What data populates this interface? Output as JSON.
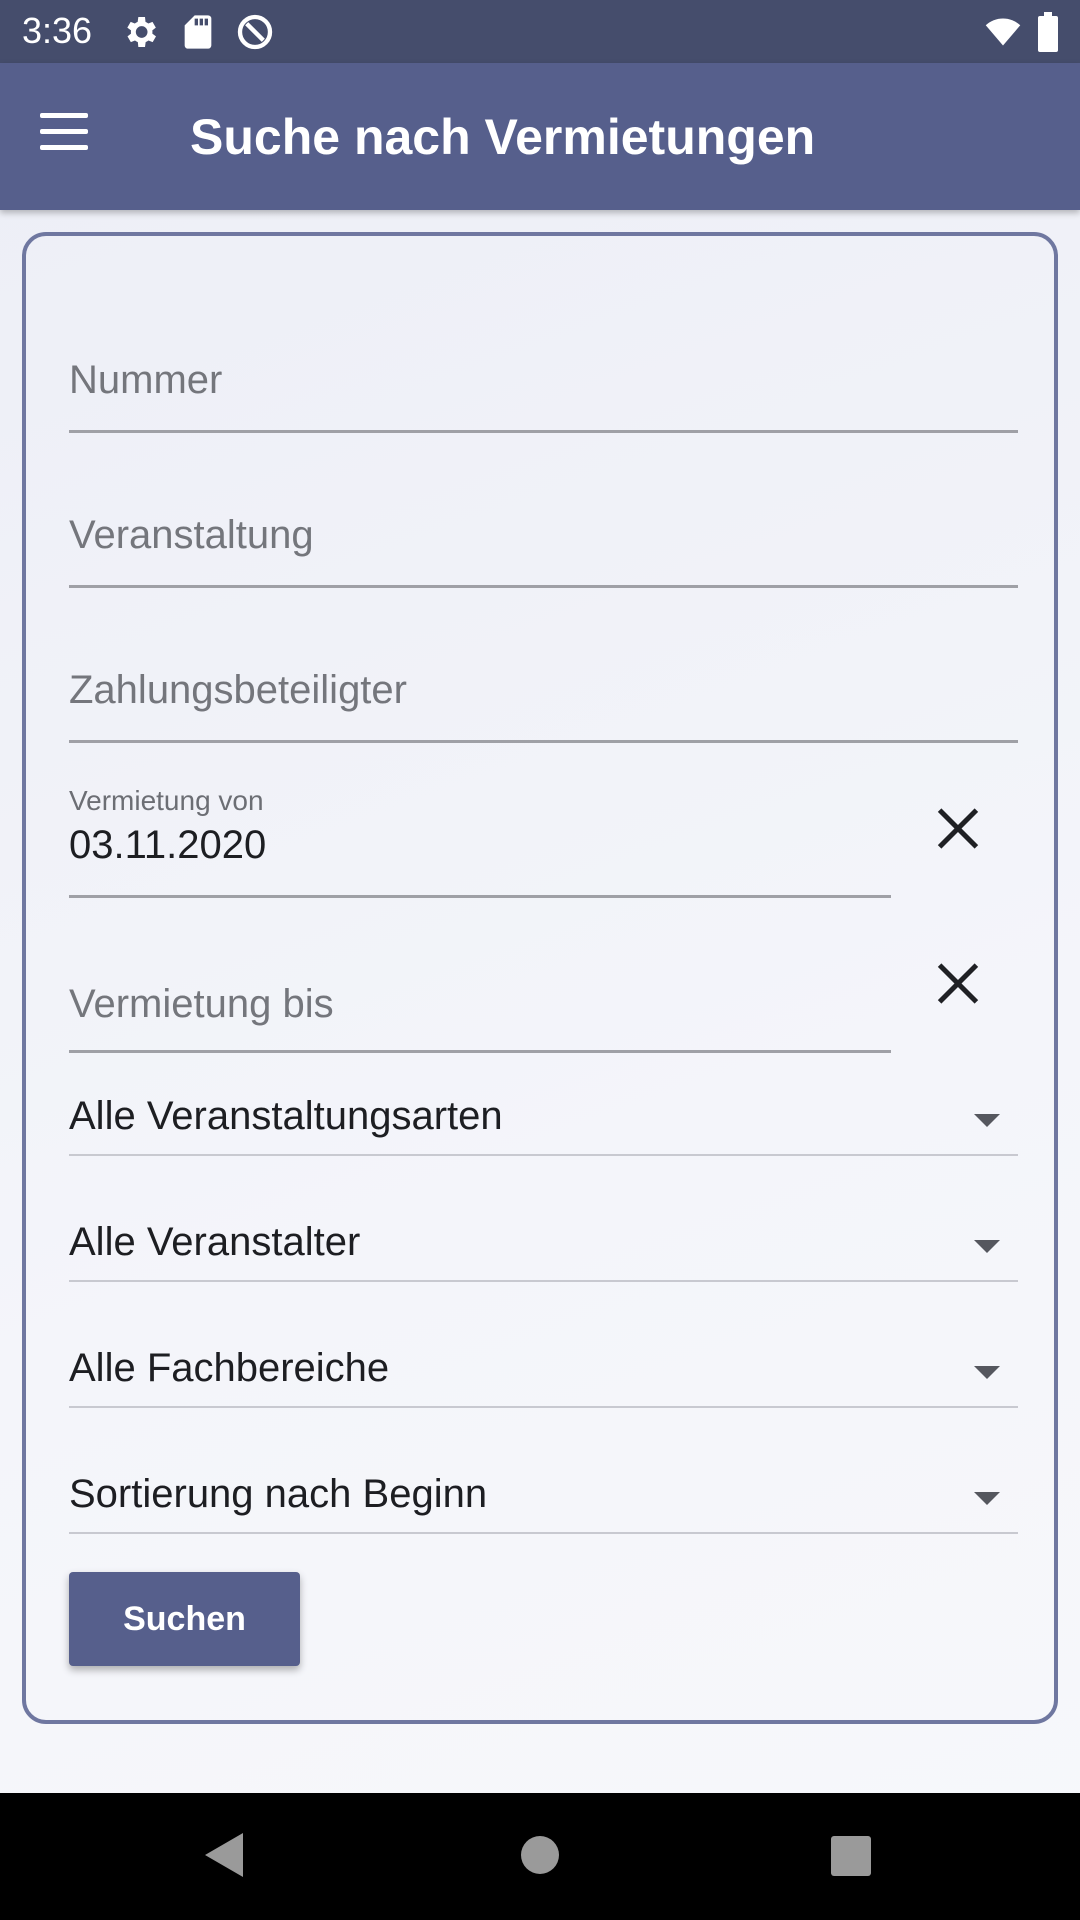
{
  "status_bar": {
    "time": "3:36",
    "icons": [
      "settings-icon",
      "sd-card-icon",
      "vpn-icon",
      "wifi-icon",
      "battery-icon"
    ]
  },
  "app_bar": {
    "title": "Suche nach Vermietungen",
    "menu_icon": "hamburger-menu-icon"
  },
  "form": {
    "nummer": {
      "placeholder": "Nummer",
      "value": ""
    },
    "veranstaltung": {
      "placeholder": "Veranstaltung",
      "value": ""
    },
    "zahlungsbeteiligter": {
      "placeholder": "Zahlungsbeteiligter",
      "value": ""
    },
    "vermietung_von": {
      "label": "Vermietung von",
      "value": "03.11.2020"
    },
    "vermietung_bis": {
      "placeholder": "Vermietung bis",
      "value": ""
    },
    "dropdowns": {
      "veranstaltungsarten": "Alle Veranstaltungsarten",
      "veranstalter": "Alle Veranstalter",
      "fachbereiche": "Alle Fachbereiche",
      "sortierung": "Sortierung nach Beginn"
    },
    "search_label": "Suchen"
  },
  "colors": {
    "status_bar": "#454d6c",
    "app_bar": "#565f8c",
    "card_border": "#6f77a0",
    "button": "#565f8c"
  }
}
